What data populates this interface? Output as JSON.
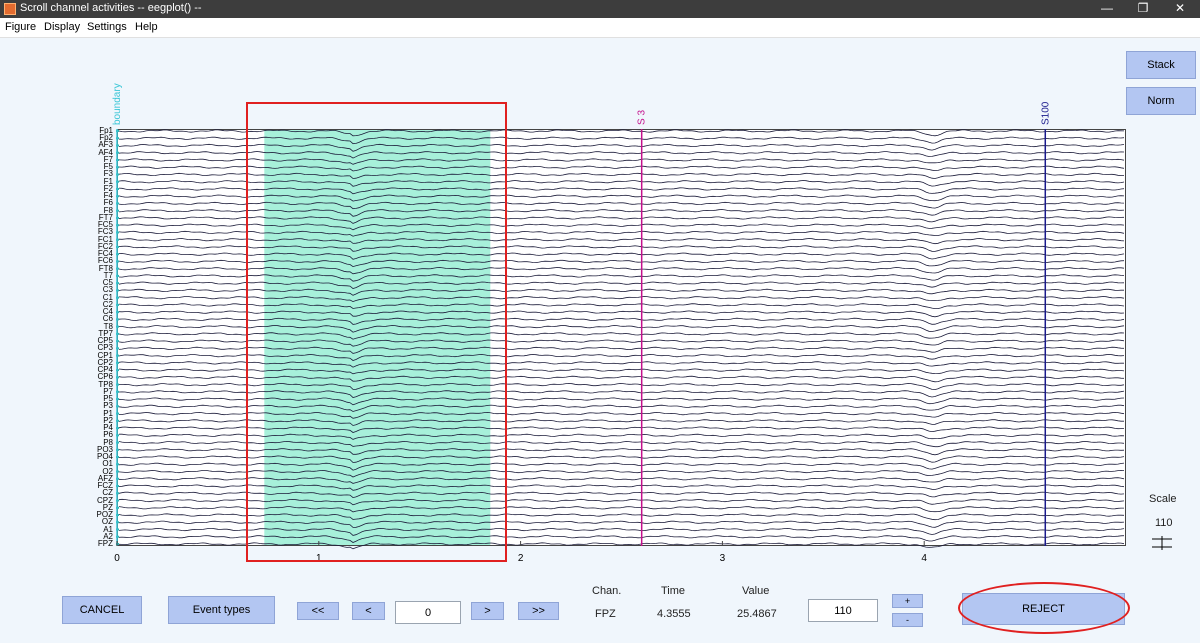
{
  "window": {
    "title": "Scroll channel activities -- eegplot() --",
    "controls": [
      "—",
      "❐",
      "✕"
    ]
  },
  "menu": [
    "Figure",
    "Display",
    "Settings",
    "Help"
  ],
  "side_buttons": {
    "stack": "Stack",
    "norm": "Norm"
  },
  "scale": {
    "label": "Scale",
    "value": "110"
  },
  "events": [
    {
      "label": "boundary",
      "time": 0,
      "color": "#3ac6d6"
    },
    {
      "label": "S 3",
      "time": 2.6,
      "color": "#c4108c"
    },
    {
      "label": "S100",
      "time": 4.6,
      "color": "#1a1a8c"
    }
  ],
  "chart_data": {
    "type": "line",
    "xlim": [
      0,
      5
    ],
    "x_ticks": [
      "0",
      "1",
      "2",
      "3",
      "4"
    ],
    "channels": [
      "Fp1",
      "Fp2",
      "AF3",
      "AF4",
      "F7",
      "F5",
      "F3",
      "F1",
      "F2",
      "F4",
      "F6",
      "F8",
      "FT7",
      "FC5",
      "FC3",
      "FC1",
      "FC2",
      "FC4",
      "FC6",
      "FT8",
      "T7",
      "C5",
      "C3",
      "C1",
      "C2",
      "C4",
      "C6",
      "T8",
      "TP7",
      "CP5",
      "CP3",
      "CP1",
      "CP2",
      "CP4",
      "CP6",
      "TP8",
      "P7",
      "P5",
      "P3",
      "P1",
      "P2",
      "P4",
      "P6",
      "P8",
      "PO3",
      "PO4",
      "O1",
      "O2",
      "AFZ",
      "FCZ",
      "CZ",
      "CPZ",
      "PZ",
      "POZ",
      "OZ",
      "A1",
      "A2",
      "FPZ"
    ],
    "selected_window": {
      "start": 0.73,
      "end": 1.85
    }
  },
  "controls": {
    "cancel": "CANCEL",
    "event_types": "Event types",
    "prev_page": "<<",
    "prev": "<",
    "position": "0",
    "next": ">",
    "next_page": ">>",
    "chan_label": "Chan.",
    "time_label": "Time",
    "value_label": "Value",
    "chan_value": "FPZ",
    "time_value": "4.3555",
    "value_value": "25.4867",
    "scale_input": "110",
    "plus": "+",
    "minus": "-",
    "reject": "REJECT"
  }
}
